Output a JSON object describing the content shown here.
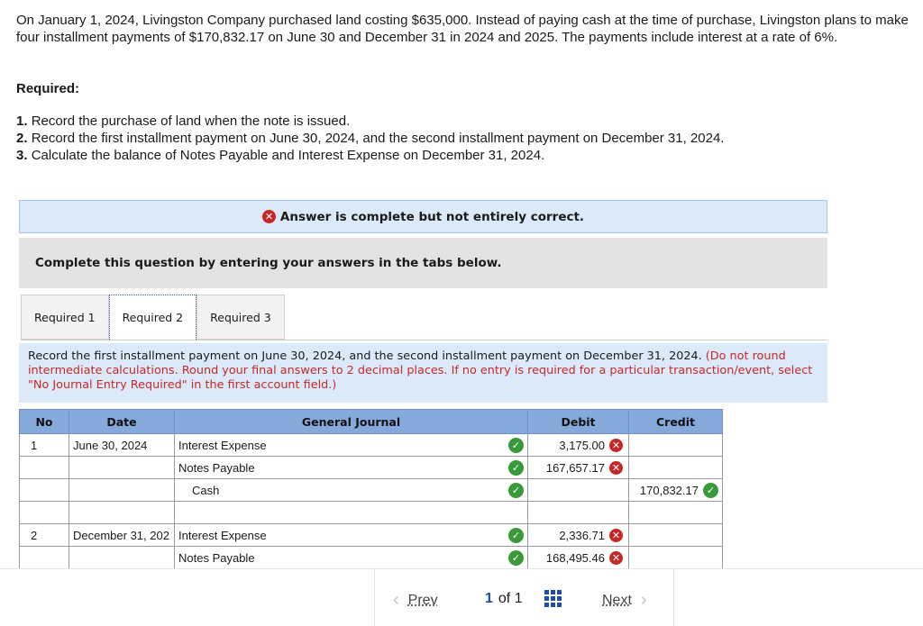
{
  "problem": {
    "intro": "On January 1, 2024, Livingston Company purchased land costing $635,000. Instead of paying cash at the time of purchase, Livingston plans to make four installment payments of $170,832.17 on June 30 and December 31 in 2024 and 2025. The payments include interest at a rate of 6%.",
    "required_heading": "Required:",
    "requirements": [
      {
        "num": "1.",
        "text": "Record the purchase of land when the note is issued."
      },
      {
        "num": "2.",
        "text": "Record the first installment payment on June 30, 2024, and the second installment payment on December 31, 2024."
      },
      {
        "num": "3.",
        "text": "Calculate the balance of Notes Payable and Interest Expense on December 31, 2024."
      }
    ]
  },
  "banner": {
    "icon": "x-circle-icon",
    "text": "Answer is complete but not entirely correct."
  },
  "instruction": "Complete this question by entering your answers in the tabs below.",
  "tabs": [
    {
      "label": "Required 1",
      "active": false
    },
    {
      "label": "Required 2",
      "active": true
    },
    {
      "label": "Required 3",
      "active": false
    }
  ],
  "prompt": {
    "text": "Record the first installment payment on June 30, 2024, and the second installment payment on December 31, 2024.",
    "note": "(Do not round intermediate calculations. Round your final answers to 2 decimal places. If no entry is required for a particular transaction/event, select \"No Journal Entry Required\" in the first account field.)"
  },
  "journal": {
    "headers": {
      "no": "No",
      "date": "Date",
      "account": "General Journal",
      "debit": "Debit",
      "credit": "Credit"
    },
    "rows": [
      {
        "no": "1",
        "date": "June 30, 2024",
        "account": "Interest Expense",
        "account_status": "correct",
        "debit": "3,175.00",
        "debit_status": "incorrect",
        "credit": "",
        "credit_status": ""
      },
      {
        "no": "",
        "date": "",
        "account": "Notes Payable",
        "account_status": "correct",
        "debit": "167,657.17",
        "debit_status": "incorrect",
        "credit": "",
        "credit_status": ""
      },
      {
        "no": "",
        "date": "",
        "account": "Cash",
        "account_status": "correct",
        "debit": "",
        "debit_status": "",
        "credit": "170,832.17",
        "credit_status": "correct"
      },
      {
        "no": "",
        "date": "",
        "account": "",
        "account_status": "",
        "debit": "",
        "debit_status": "",
        "credit": "",
        "credit_status": ""
      },
      {
        "no": "2",
        "date": "December 31, 202",
        "account": "Interest Expense",
        "account_status": "correct",
        "debit": "2,336.71",
        "debit_status": "incorrect",
        "credit": "",
        "credit_status": ""
      },
      {
        "no": "",
        "date": "",
        "account": "Notes Payable",
        "account_status": "correct",
        "debit": "168,495.46",
        "debit_status": "incorrect",
        "credit": "",
        "credit_status": ""
      }
    ]
  },
  "pagination": {
    "prev_label": "Prev",
    "current": "1",
    "of_label": "of",
    "total": "1",
    "next_label": "Next"
  },
  "colors": {
    "correct": "#3a9a3a",
    "incorrect": "#c62828",
    "header_blue": "#86a9dc",
    "banner_blue": "#dce9f8"
  }
}
